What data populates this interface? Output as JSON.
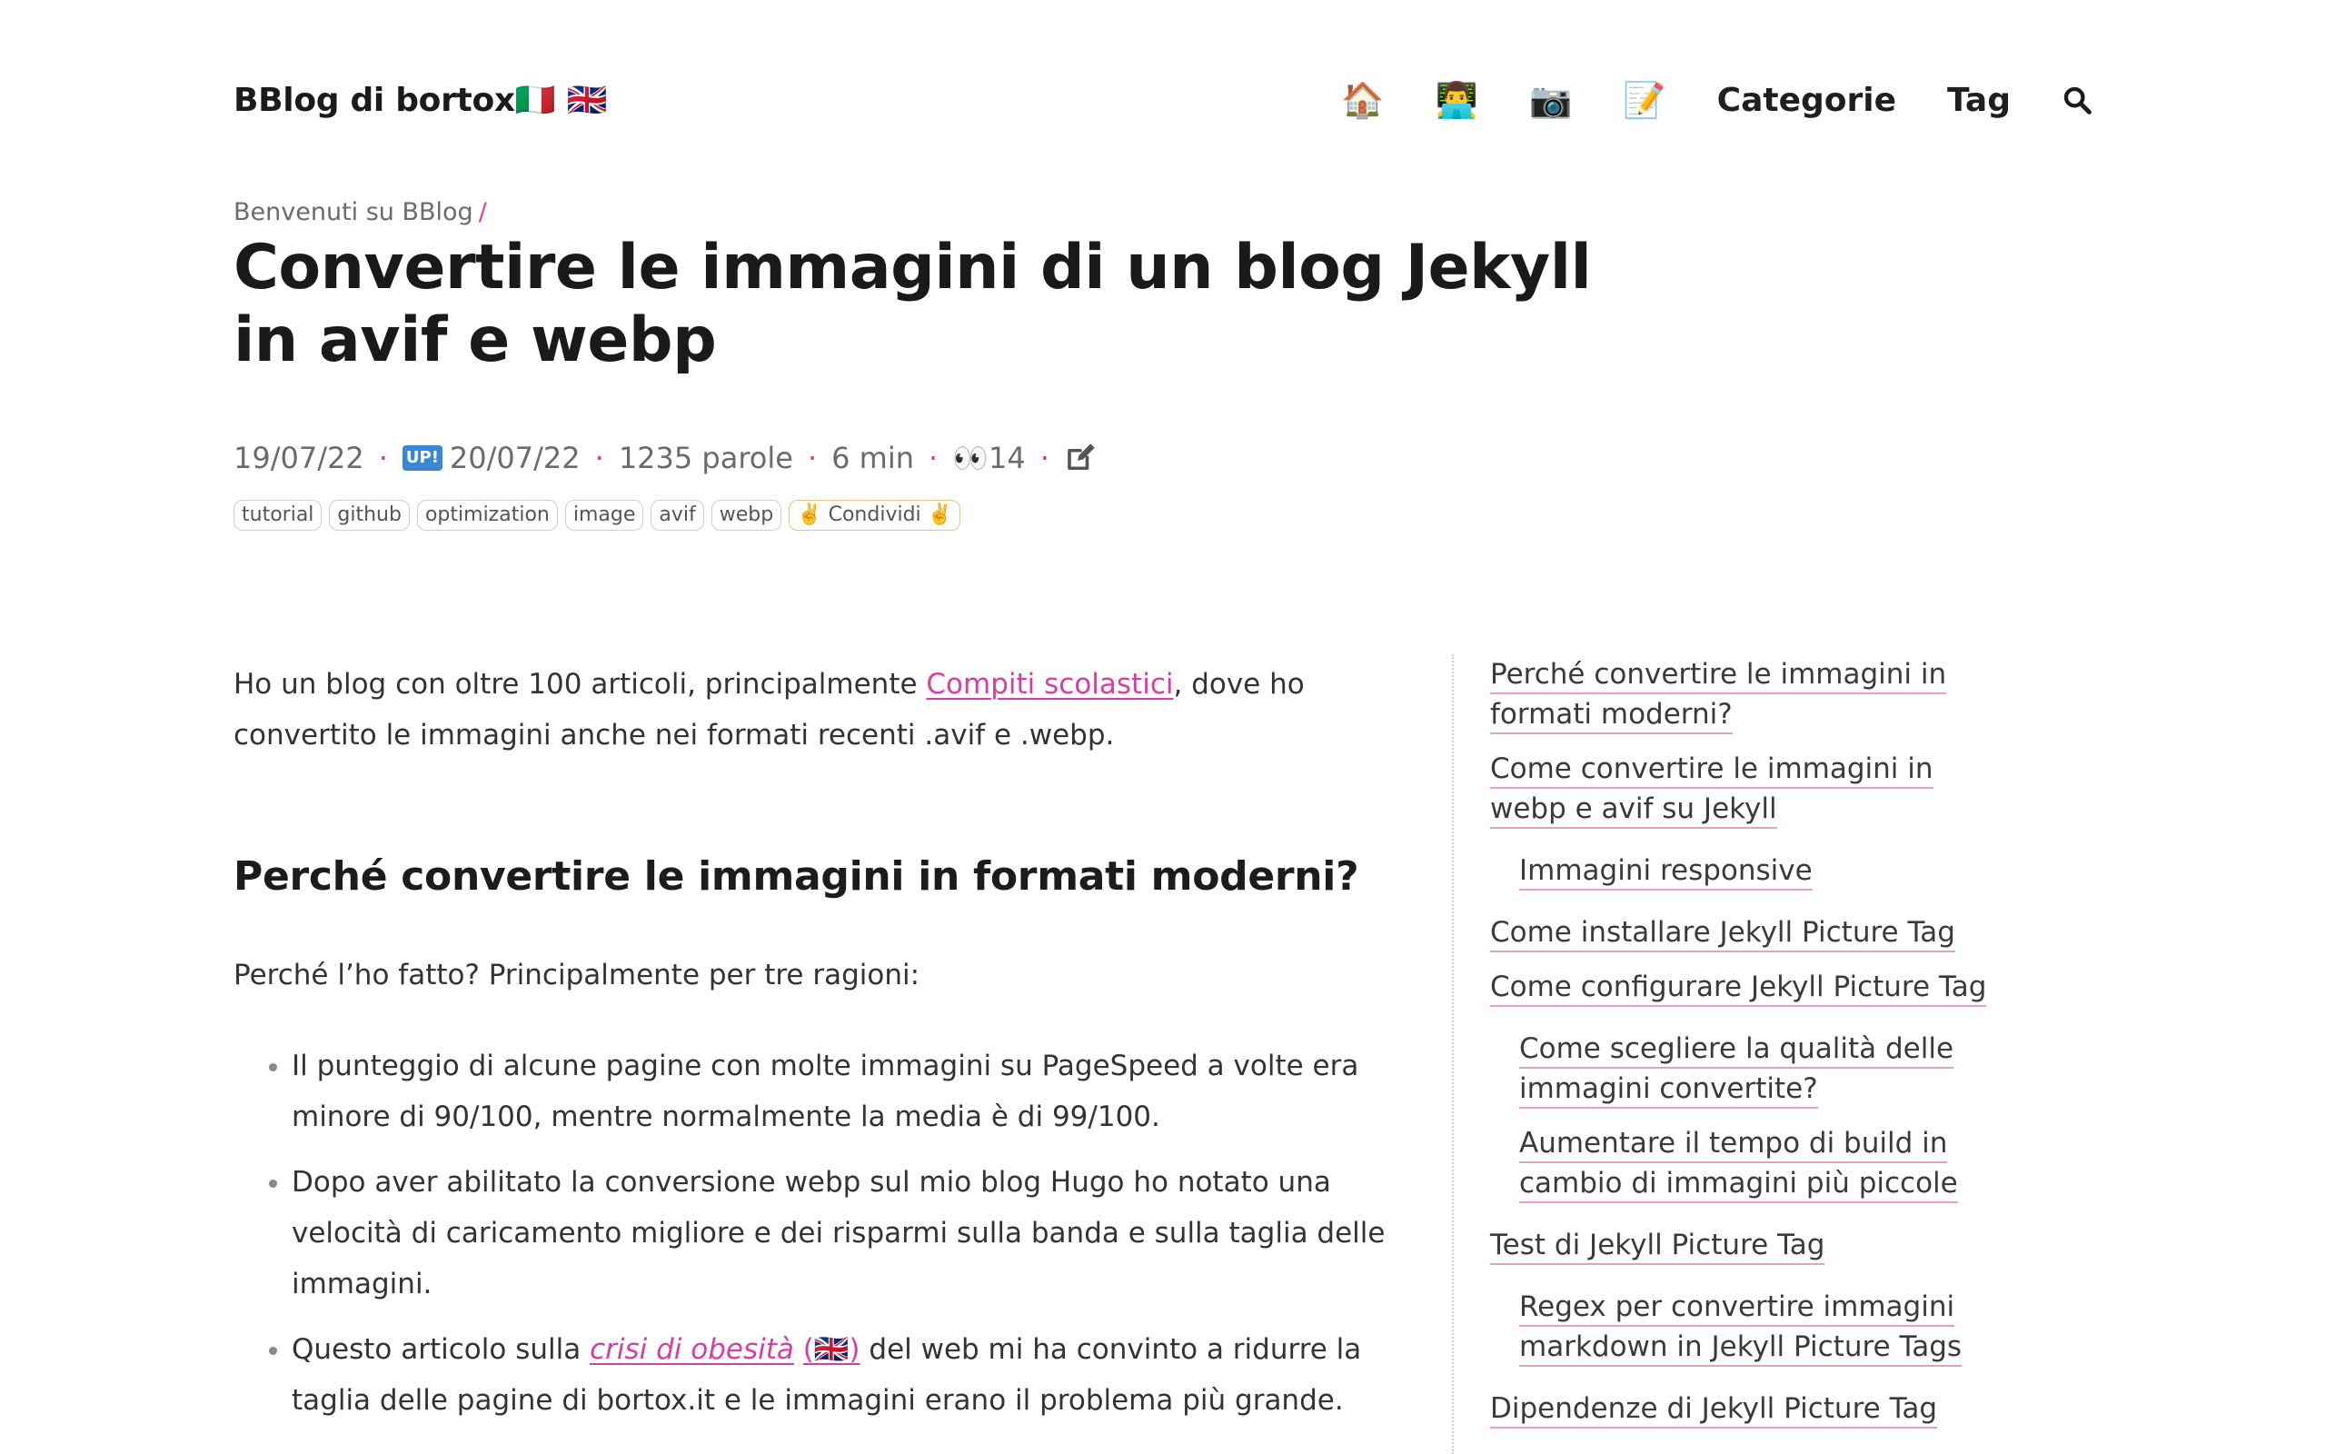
{
  "header": {
    "site_title": "BBlog di bortox🇮🇹 🇬🇧",
    "nav": {
      "home_emoji": "🏠",
      "dev_emoji": "👨‍💻",
      "camera_emoji": "📷",
      "memo_emoji": "📝",
      "categories": "Categorie",
      "tags": "Tag"
    }
  },
  "breadcrumb": {
    "home": "Benvenuti su BBlog",
    "separator": "/"
  },
  "post": {
    "title": "Convertire le immagini di un blog Jekyll in avif e webp",
    "meta": {
      "published": "19/07/22",
      "up_badge": "UP!",
      "updated": "20/07/22",
      "words": "1235 parole",
      "reading_time": "6 min",
      "views": "👀14"
    },
    "tags": [
      "tutorial",
      "github",
      "optimization",
      "image",
      "avif",
      "webp"
    ],
    "share": "✌️ Condividi ✌️"
  },
  "content": {
    "intro_before": "Ho un blog con oltre 100 articoli, principalmente ",
    "intro_link": "Compiti scolastici",
    "intro_after": ", dove ho convertito le immagini anche nei formati recenti .avif e .webp.",
    "heading1": "Perché convertire le immagini in formati moderni?",
    "p2": "Perché l’ho fatto? Principalmente per tre ragioni:",
    "bullets": {
      "b1": "Il punteggio di alcune pagine con molte immagini su PageSpeed a volte era minore di 90/100, mentre normalmente la media è di 99/100.",
      "b2": "Dopo aver abilitato la conversione webp sul mio blog Hugo ho notato una velocità di caricamento migliore e dei risparmi sulla banda e sulla taglia delle immagini.",
      "b3_before": "Questo articolo sulla ",
      "b3_link": "crisi di obesità",
      "b3_flag": "(🇬🇧)",
      "b3_after": " del web mi ha convinto a ridurre la taglia delle pagine di bortox.it e le immagini erano il problema più grande."
    }
  },
  "toc": [
    "Perché convertire le immagini in formati moderni?",
    "Come convertire le immagini in webp e avif su Jekyll",
    "Immagini responsive",
    "Come installare Jekyll Picture Tag",
    "Come configurare Jekyll Picture Tag",
    "Come scegliere la qualità delle immagini convertite?",
    "Aumentare il tempo di build in cambio di immagini più piccole",
    "Test di Jekyll Picture Tag",
    "Regex per convertire immagini markdown in Jekyll Picture Tags",
    "Dipendenze di Jekyll Picture Tag"
  ]
}
